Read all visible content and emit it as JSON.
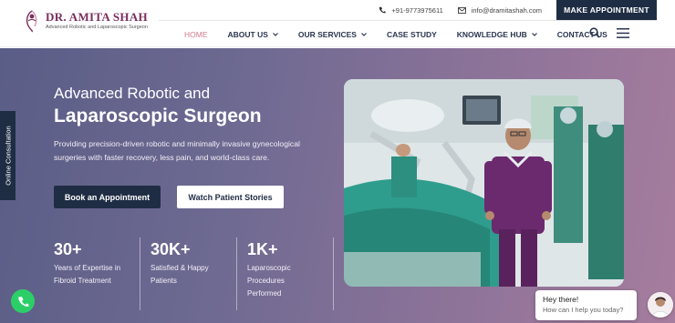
{
  "header": {
    "logo": {
      "name": "DR. AMITA SHAH",
      "tagline": "Advanced Robotic and Laparoscopic Surgeon"
    },
    "topbar": {
      "phone": "+91-9773975611",
      "email": "info@dramitashah.com",
      "cta_label": "MAKE APPOINTMENT"
    },
    "nav": {
      "items": [
        {
          "label": "HOME",
          "active": true,
          "dropdown": false
        },
        {
          "label": "ABOUT US",
          "active": false,
          "dropdown": true
        },
        {
          "label": "OUR SERVICES",
          "active": false,
          "dropdown": true
        },
        {
          "label": "CASE STUDY",
          "active": false,
          "dropdown": false
        },
        {
          "label": "KNOWLEDGE HUB",
          "active": false,
          "dropdown": true
        },
        {
          "label": "CONTACT US",
          "active": false,
          "dropdown": false
        }
      ],
      "icons": [
        "search-icon",
        "menu-icon"
      ]
    }
  },
  "hero": {
    "title_line1": "Advanced Robotic and",
    "title_line2": "Laparoscopic Surgeon",
    "description": "Providing precision-driven robotic and minimally invasive gynecological surgeries with faster recovery, less pain, and world-class care.",
    "primary_button": "Book an Appointment",
    "secondary_button": "Watch Patient Stories",
    "stats": [
      {
        "value": "30+",
        "label_lines": [
          "Years of Expertise in",
          "Fibroid Treatment"
        ]
      },
      {
        "value": "30K+",
        "label_lines": [
          "Satisfied & Happy",
          "Patients"
        ]
      },
      {
        "value": "1K+",
        "label_lines": [
          "Laparoscopic",
          "Procedures",
          "Performed"
        ]
      }
    ]
  },
  "side_tab": {
    "label": "Online Consultation"
  },
  "chat": {
    "title": "Hey there!",
    "subtitle": "How can I help you today?"
  },
  "colors": {
    "navy": "#1f2d44",
    "brand_maroon": "#7a2f5c",
    "nav_active": "#d17a8c",
    "hero_gradient_start": "#5a5d86",
    "hero_gradient_end": "#a67d9e",
    "whatsapp_green": "#2ccf67"
  }
}
